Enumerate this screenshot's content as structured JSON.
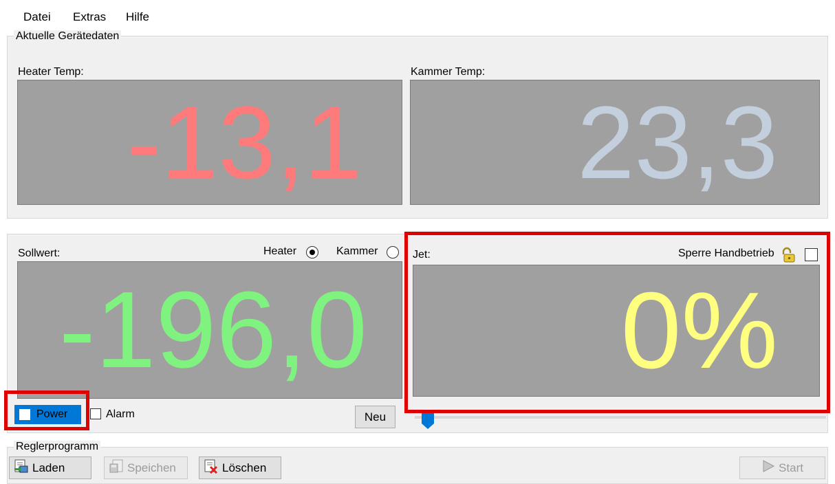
{
  "menu": {
    "file": "Datei",
    "extras": "Extras",
    "help": "Hilfe"
  },
  "current_data": {
    "title": "Aktuelle Gerätedaten",
    "heater_label": "Heater Temp:",
    "heater_value": "-13,1",
    "kammer_label": "Kammer Temp:",
    "kammer_value": "23,3"
  },
  "setpoint": {
    "label": "Sollwert:",
    "value": "-196,0",
    "radio_heater": "Heater",
    "radio_kammer": "Kammer",
    "selected": "Heater",
    "power_label": "Power",
    "alarm_label": "Alarm",
    "new_button": "Neu"
  },
  "jet": {
    "label": "Jet:",
    "lock_label": "Sperre Handbetrieb",
    "value": "0%",
    "slider_level": 0
  },
  "program": {
    "title": "Reglerprogramm",
    "load": "Laden",
    "save": "Speichen",
    "delete": "Löschen",
    "start": "Start"
  },
  "colors": {
    "heater": "#ff7b7b",
    "kammer": "#c3cfdd",
    "setpoint": "#7ff27f",
    "jet": "#ffff80",
    "highlight": "#e00000",
    "accent": "#0078d7"
  }
}
